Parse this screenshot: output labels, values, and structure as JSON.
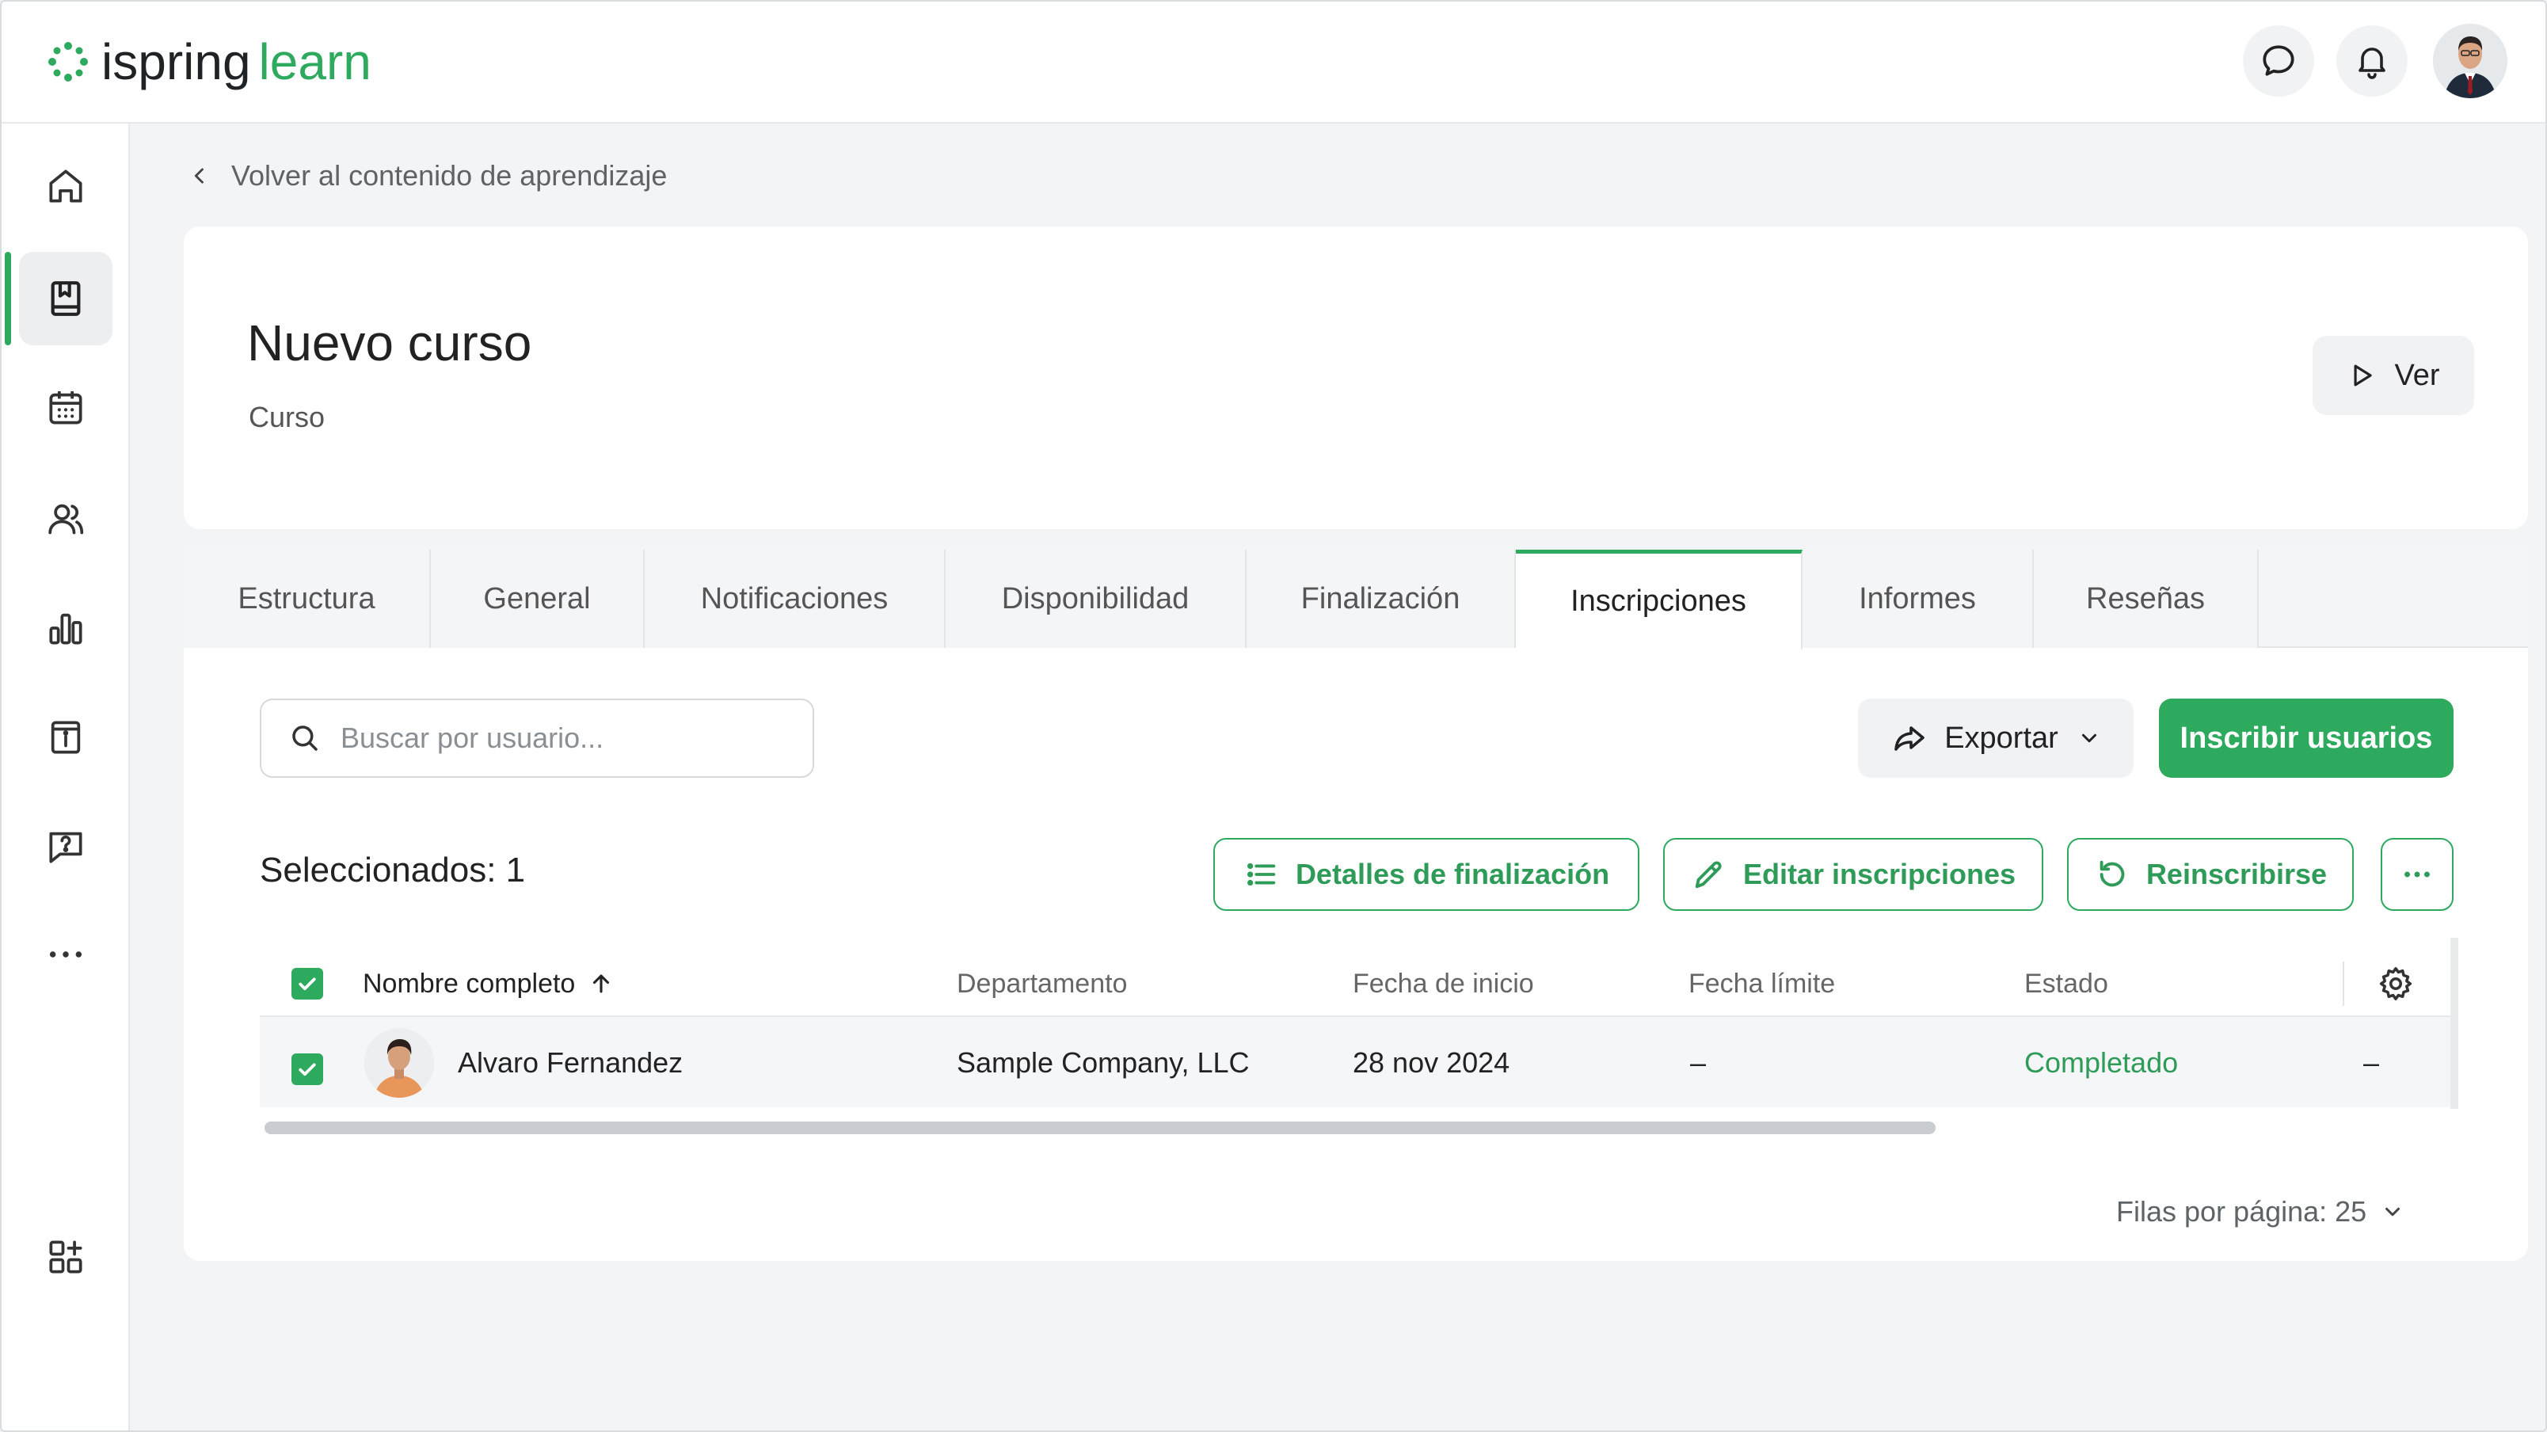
{
  "app": {
    "logo_part1": "ispring",
    "logo_part2": "learn",
    "brand_color": "#2eaa5f"
  },
  "header": {
    "icons": [
      "chat-bubble-icon",
      "bell-icon",
      "user-avatar"
    ]
  },
  "sidebar": {
    "items": [
      {
        "name": "home",
        "icon": "home-icon"
      },
      {
        "name": "learning-content",
        "icon": "book-icon",
        "active": true
      },
      {
        "name": "calendar",
        "icon": "calendar-icon"
      },
      {
        "name": "users",
        "icon": "users-icon"
      },
      {
        "name": "reports",
        "icon": "bar-chart-icon"
      },
      {
        "name": "info",
        "icon": "info-board-icon"
      },
      {
        "name": "help",
        "icon": "question-chat-icon"
      },
      {
        "name": "more",
        "icon": "more-dots-icon"
      },
      {
        "name": "add-apps",
        "icon": "apps-add-icon"
      }
    ]
  },
  "breadcrumb": {
    "back_label": "Volver al contenido de aprendizaje"
  },
  "course": {
    "title": "Nuevo curso",
    "type": "Curso",
    "view_label": "Ver"
  },
  "tabs": [
    {
      "label": "Estructura"
    },
    {
      "label": "General"
    },
    {
      "label": "Notificaciones"
    },
    {
      "label": "Disponibilidad"
    },
    {
      "label": "Finalización"
    },
    {
      "label": "Inscripciones",
      "active": true
    },
    {
      "label": "Informes"
    },
    {
      "label": "Reseñas"
    }
  ],
  "toolbar": {
    "search_placeholder": "Buscar por usuario...",
    "export_label": "Exportar",
    "enroll_label": "Inscribir usuarios"
  },
  "selection": {
    "selected_text": "Seleccionados: 1",
    "details_label": "Detalles de finalización",
    "edit_label": "Editar inscripciones",
    "reenroll_label": "Reinscribirse"
  },
  "table": {
    "columns": [
      "Nombre completo",
      "Departamento",
      "Fecha de inicio",
      "Fecha límite",
      "Estado"
    ],
    "rows": [
      {
        "name": "Alvaro Fernandez",
        "department": "Sample Company, LLC",
        "start_date": "28 nov 2024",
        "due_date": "–",
        "status": "Completado",
        "extra": "–",
        "checked": true
      }
    ],
    "status_color": "#2eaa5f"
  },
  "pagination": {
    "rows_per_page": "Filas por página: 25"
  }
}
